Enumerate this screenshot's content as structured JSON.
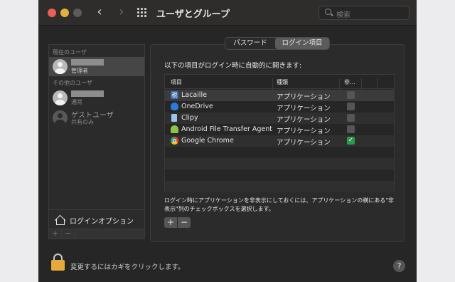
{
  "window": {
    "title": "ユーザとグループ",
    "search_placeholder": "検索",
    "back_glyph": "‹",
    "forward_glyph": "›",
    "traffic_colors": {
      "close": "#ec5f56",
      "minimize": "#e3b23c",
      "zoom": "#5c5b5a"
    }
  },
  "sidebar": {
    "current_users_label": "現在のユーザ",
    "current_user": {
      "role": "管理者"
    },
    "other_users_label": "その他のユーザ",
    "other_user": {
      "role": "通常"
    },
    "guest": {
      "name": "ゲストユーザ",
      "role": "共有のみ"
    },
    "login_options_label": "ログインオプション",
    "add_label": "+",
    "remove_label": "−"
  },
  "tabs": [
    {
      "label": "パスワード",
      "selected": false
    },
    {
      "label": "ログイン項目",
      "selected": true
    }
  ],
  "login_items": {
    "intro": "以下の項目がログイン時に自動的に開きます:",
    "columns": {
      "item": "項目",
      "kind": "種類",
      "hide": "非…"
    },
    "rows": [
      {
        "icon": "lacaille-icon",
        "icon_glyph": "税",
        "name": "Lacaille",
        "kind": "アプリケーション",
        "hidden": false
      },
      {
        "icon": "onedrive-icon",
        "icon_glyph": "",
        "name": "OneDrive",
        "kind": "アプリケーション",
        "hidden": false
      },
      {
        "icon": "clipy-icon",
        "icon_glyph": "",
        "name": "Clipy",
        "kind": "アプリケーション",
        "hidden": false
      },
      {
        "icon": "android-icon",
        "icon_glyph": "",
        "name": "Android File Transfer Agent",
        "kind": "アプリケーション",
        "hidden": false
      },
      {
        "icon": "chrome-icon",
        "icon_glyph": "",
        "name": "Google Chrome",
        "kind": "アプリケーション",
        "hidden": true
      }
    ],
    "help_text": "ログイン時にアプリケーションを非表示にしておくには、アプリケーションの横にある\"非表示\"列のチェックボックスを選択します。",
    "add_label": "+",
    "remove_label": "−"
  },
  "footer": {
    "lock_text": "変更するにはカギをクリックします。",
    "help_label": "?"
  },
  "colors": {
    "check_on": "#2e9a48",
    "lock": "#e7a93a",
    "selected_tab": "#5b5b5b"
  }
}
